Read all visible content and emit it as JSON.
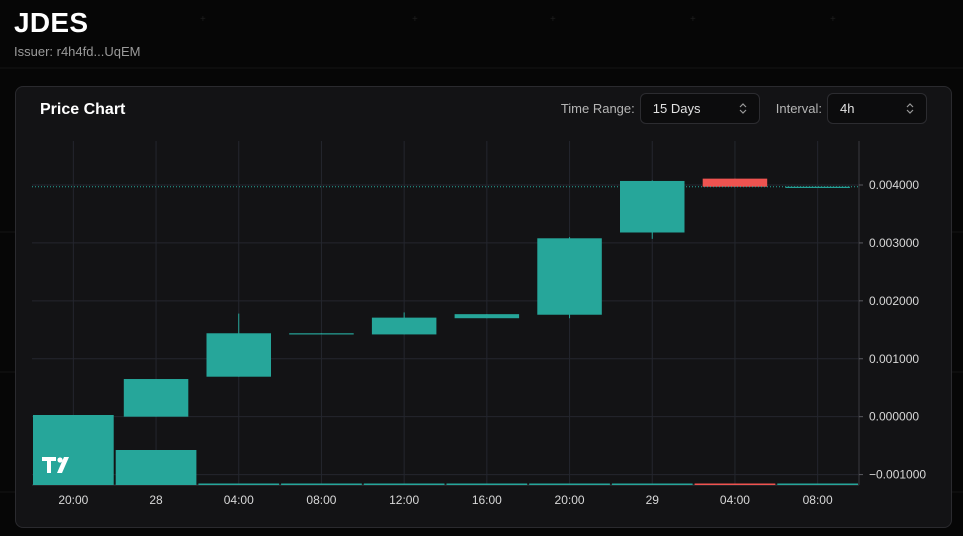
{
  "token": {
    "symbol": "JDES",
    "issuer": "Issuer: r4h4fd...UqEM"
  },
  "card": {
    "title": "Price Chart",
    "time_range": {
      "label": "Time Range:",
      "value": "15 Days"
    },
    "interval": {
      "label": "Interval:",
      "value": "4h"
    }
  },
  "colors": {
    "up": "#26a69a",
    "down": "#ef5350",
    "grid": "#24262e",
    "axis_text": "#d8d8d8"
  },
  "icons": {
    "logo": "tradingview-logo-icon",
    "chevron": "chevron-up-down-icon"
  },
  "chart_data": {
    "type": "candlestick",
    "x_tick_labels": [
      "20:00",
      "28",
      "04:00",
      "08:00",
      "12:00",
      "16:00",
      "20:00",
      "29",
      "04:00",
      "08:00"
    ],
    "y_tick_values": [
      0.004,
      0.003,
      0.002,
      0.001,
      0.0,
      -0.001
    ],
    "y_tick_labels": [
      "0.004000",
      "0.003000",
      "0.002000",
      "0.001000",
      "0.000000",
      "−0.001000"
    ],
    "ylim": [
      -0.00118,
      0.00476
    ],
    "last_price": 0.00397,
    "candles": [
      {
        "x": "20:00",
        "open": 0.0,
        "close": 0.0,
        "high": 0.0,
        "low": 0.0
      },
      {
        "x": "28",
        "open": 0.0,
        "close": 0.00065,
        "high": 0.00065,
        "low": 0.0
      },
      {
        "x": "04:00",
        "open": 0.00069,
        "close": 0.00144,
        "high": 0.00178,
        "low": 0.00069
      },
      {
        "x": "08:00",
        "open": 0.00143,
        "close": 0.00144,
        "high": 0.00144,
        "low": 0.00143
      },
      {
        "x": "12:00",
        "open": 0.00142,
        "close": 0.00171,
        "high": 0.0018,
        "low": 0.00142
      },
      {
        "x": "16:00",
        "open": 0.0017,
        "close": 0.00177,
        "high": 0.00177,
        "low": 0.0017
      },
      {
        "x": "20:00",
        "open": 0.00176,
        "close": 0.00308,
        "high": 0.0031,
        "low": 0.0017
      },
      {
        "x": "29",
        "open": 0.00318,
        "close": 0.00407,
        "high": 0.00408,
        "low": 0.00307
      },
      {
        "x": "04:00",
        "open": 0.00411,
        "close": 0.00397,
        "high": 0.00411,
        "low": 0.00397
      },
      {
        "x": "08:00",
        "open": 0.00397,
        "close": 0.00397,
        "high": 0.00397,
        "low": 0.00397
      }
    ],
    "volume_fraction": [
      1.0,
      0.5,
      0.015,
      0.01,
      0.015,
      0.01,
      0.015,
      0.015,
      0.01,
      0.01
    ]
  }
}
